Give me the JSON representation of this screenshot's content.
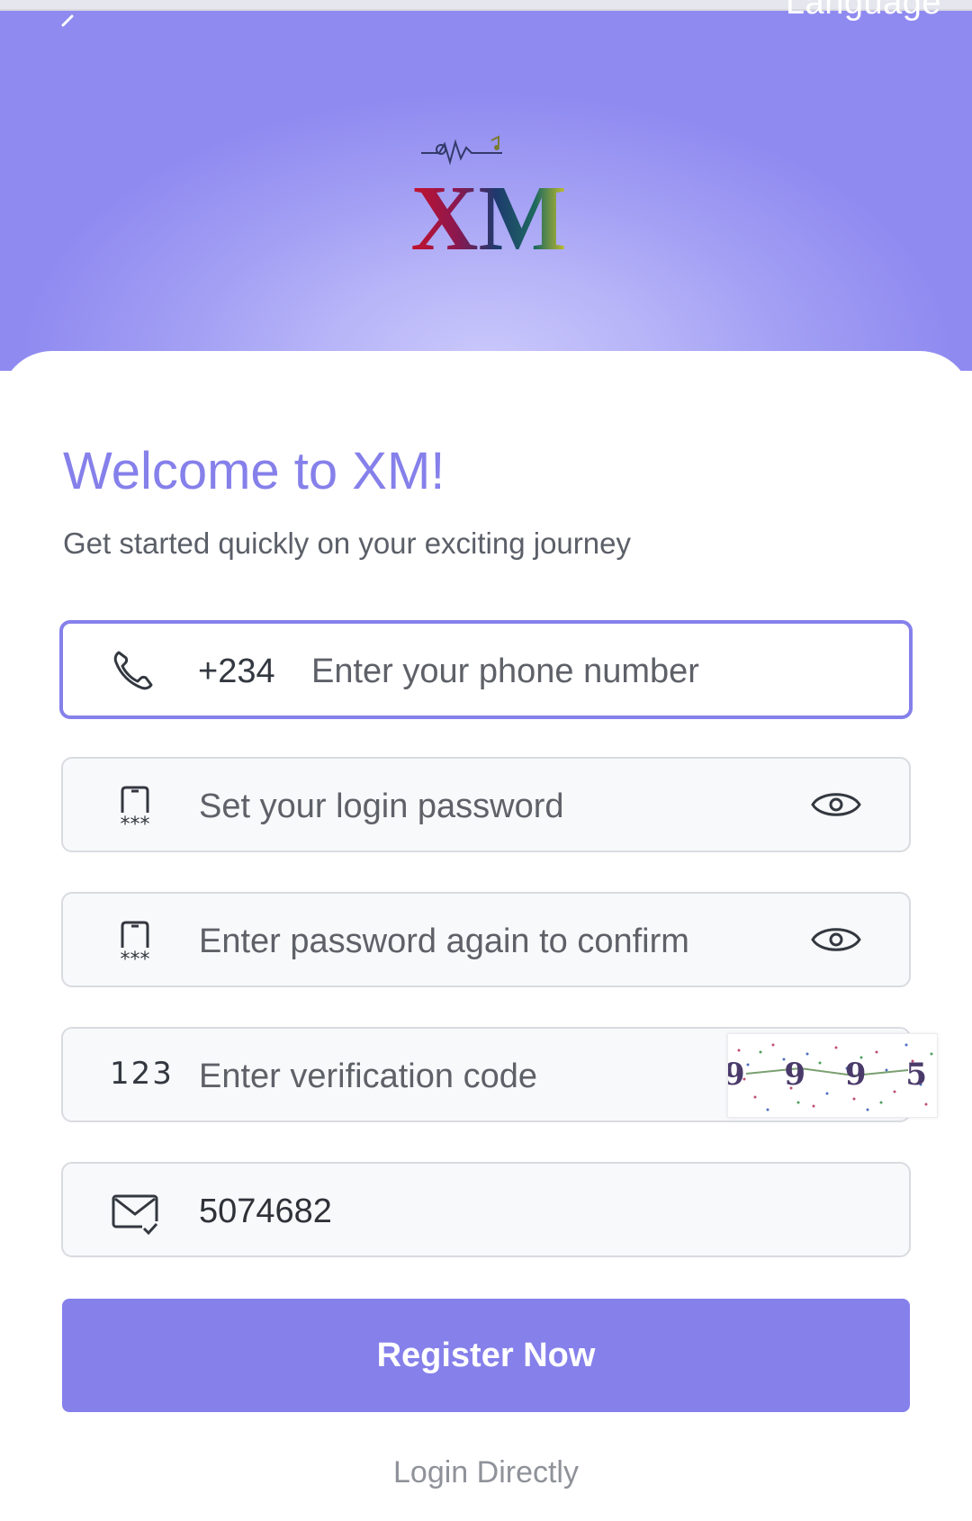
{
  "header": {
    "language_label": "Language",
    "logo_text": "XM"
  },
  "welcome": {
    "title": "Welcome to XM!",
    "subtitle": "Get started quickly on your exciting journey"
  },
  "form": {
    "phone": {
      "prefix": "+234",
      "placeholder": "Enter your phone number"
    },
    "password": {
      "placeholder": "Set your login password"
    },
    "confirm_password": {
      "placeholder": "Enter password again to confirm"
    },
    "verification": {
      "icon_text": "123",
      "placeholder": "Enter verification code",
      "captcha_text": "9 9 9 5"
    },
    "invite_code": {
      "value": "5074682"
    }
  },
  "actions": {
    "register_label": "Register Now",
    "login_label": "Login Directly"
  },
  "colors": {
    "accent": "#8580ea",
    "hero_light": "#cac8fb",
    "hero_dark": "#8f8af0"
  }
}
